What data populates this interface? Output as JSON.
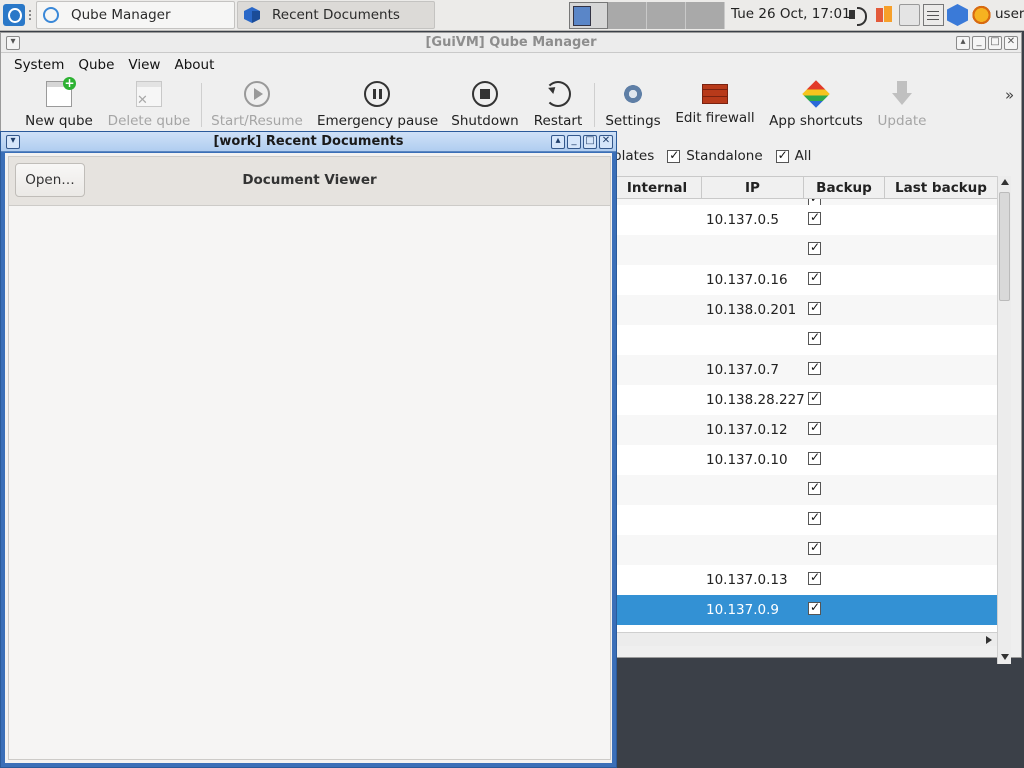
{
  "taskbar": {
    "tasks": [
      {
        "label": "Qube Manager",
        "icon": "qubes-manager-icon"
      },
      {
        "label": "Recent Documents",
        "icon": "cube-icon"
      }
    ],
    "clock": "Tue 26 Oct, 17:01",
    "user": "user",
    "tray_icons": [
      "speaker-muted-icon",
      "disk-usage-icon",
      "drive-icon",
      "clipboard-icon",
      "qube-domains-icon",
      "updates-sun-icon"
    ]
  },
  "qube_manager": {
    "title": "[GuiVM] Qube Manager",
    "menu": [
      "System",
      "Qube",
      "View",
      "About"
    ],
    "toolbar": [
      {
        "label": "New qube",
        "icon": "new-qube-icon",
        "enabled": true
      },
      {
        "label": "Delete qube",
        "icon": "delete-qube-icon",
        "enabled": false
      },
      {
        "label": "Start/Resume",
        "icon": "play-icon",
        "enabled": false
      },
      {
        "label": "Emergency pause",
        "icon": "pause-icon",
        "enabled": true
      },
      {
        "label": "Shutdown",
        "icon": "stop-icon",
        "enabled": true
      },
      {
        "label": "Restart",
        "icon": "restart-icon",
        "enabled": true
      },
      {
        "label": "Settings",
        "icon": "settings-gear-icon",
        "enabled": true
      },
      {
        "label": "Edit firewall",
        "icon": "firewall-icon",
        "enabled": true
      },
      {
        "label": "App shortcuts",
        "icon": "app-shortcuts-icon",
        "enabled": true
      },
      {
        "label": "Update",
        "icon": "update-icon",
        "enabled": false
      }
    ],
    "more_glyph": "»",
    "filters": [
      {
        "label": "plates",
        "checked": null
      },
      {
        "label": "Standalone",
        "checked": true
      },
      {
        "label": "All",
        "checked": true
      }
    ],
    "table": {
      "columns": [
        "Internal",
        "IP",
        "Backup",
        "Last backup"
      ],
      "rows": [
        {
          "ip": "",
          "backup": true,
          "partial": true
        },
        {
          "ip": "10.137.0.5",
          "backup": true
        },
        {
          "ip": "",
          "backup": true
        },
        {
          "ip": "10.137.0.16",
          "backup": true
        },
        {
          "ip": "10.138.0.201",
          "backup": true
        },
        {
          "ip": "",
          "backup": true
        },
        {
          "ip": "10.137.0.7",
          "backup": true
        },
        {
          "ip": "10.138.28.227",
          "backup": true
        },
        {
          "ip": "10.137.0.12",
          "backup": true
        },
        {
          "ip": "10.137.0.10",
          "backup": true
        },
        {
          "ip": "",
          "backup": true
        },
        {
          "ip": "",
          "backup": true
        },
        {
          "ip": "",
          "backup": true
        },
        {
          "ip": "10.137.0.13",
          "backup": true
        },
        {
          "ip": "10.137.0.9",
          "backup": true,
          "selected": true
        }
      ]
    }
  },
  "recent_documents": {
    "title": "[work] Recent Documents",
    "open_button": "Open…",
    "header_title": "Document Viewer"
  }
}
